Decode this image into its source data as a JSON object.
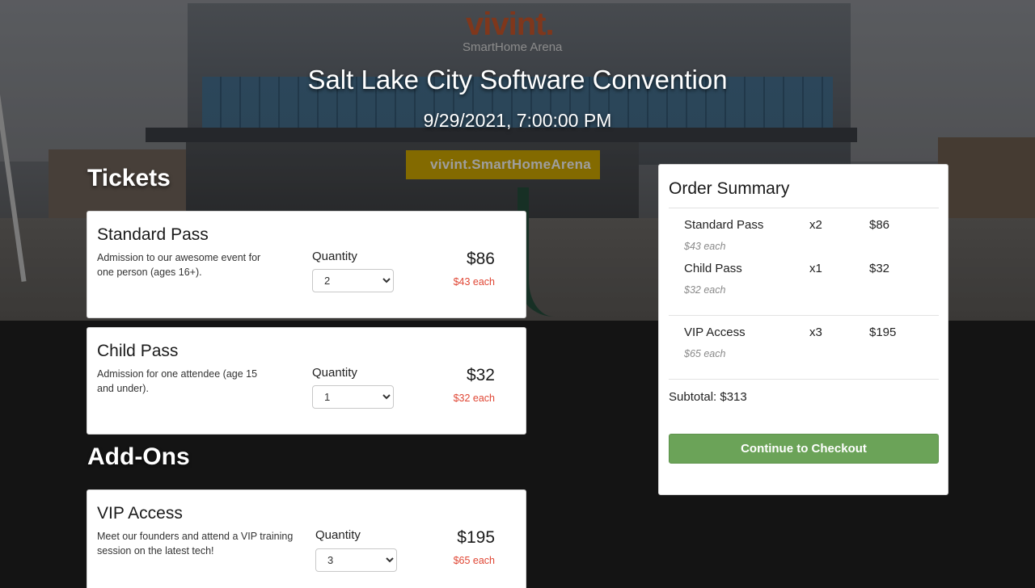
{
  "event": {
    "title": "Salt Lake City Software Convention",
    "date": "9/29/2021, 7:00:00 PM"
  },
  "hero": {
    "logo_text": "vivint.",
    "logo_sub": "SmartHome Arena",
    "sign_text": "vivint.SmartHomeArena"
  },
  "sections": {
    "tickets": "Tickets",
    "addons": "Add-Ons"
  },
  "quantity_label": "Quantity",
  "tickets": [
    {
      "name": "Standard Pass",
      "description": "Admission to our awesome event for one person (ages 16+).",
      "quantity": "2",
      "total": "$86",
      "each": "$43 each"
    },
    {
      "name": "Child Pass",
      "description": "Admission for one attendee (age 15 and under).",
      "quantity": "1",
      "total": "$32",
      "each": "$32 each"
    }
  ],
  "addons": [
    {
      "name": "VIP Access",
      "description": "Meet our founders and attend a VIP training session on the latest tech!",
      "quantity": "3",
      "total": "$195",
      "each": "$65 each"
    }
  ],
  "summary": {
    "title": "Order Summary",
    "lines": [
      {
        "name": "Standard Pass",
        "qty": "x2",
        "price": "$86",
        "each": "$43 each"
      },
      {
        "name": "Child Pass",
        "qty": "x1",
        "price": "$32",
        "each": "$32 each"
      },
      {
        "name": "VIP Access",
        "qty": "x3",
        "price": "$195",
        "each": "$65 each"
      }
    ],
    "subtotal": "Subtotal: $313",
    "checkout_label": "Continue to Checkout"
  },
  "colors": {
    "page_bg": "#141414",
    "price_each": "#e04634",
    "checkout_button": "#6ba358"
  }
}
